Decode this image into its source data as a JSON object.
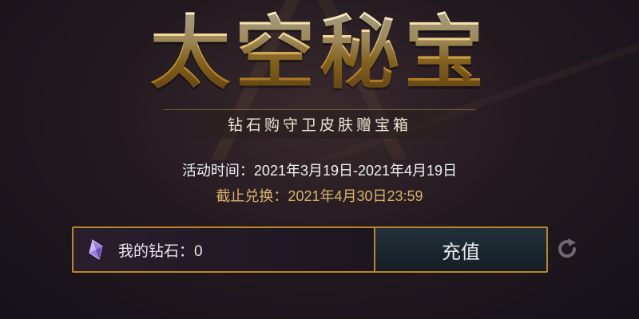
{
  "header": {
    "title": "太空秘宝",
    "subtitle": "钻石购守卫皮肤赠宝箱"
  },
  "event": {
    "time_label": "活动时间：2021年3月19日-2021年4月19日",
    "deadline_label": "截止兑换：2021年4月30日23:59"
  },
  "wallet": {
    "icon": "purple-diamond-icon",
    "label": "我的钻石：",
    "value": "0"
  },
  "recharge_button": {
    "label": "充值"
  },
  "refresh": {
    "icon": "refresh-icon"
  },
  "colors": {
    "accent_gold": "#b8862f",
    "deadline_text": "#d9b26b",
    "diamond_purple": "#9a7fe0"
  }
}
